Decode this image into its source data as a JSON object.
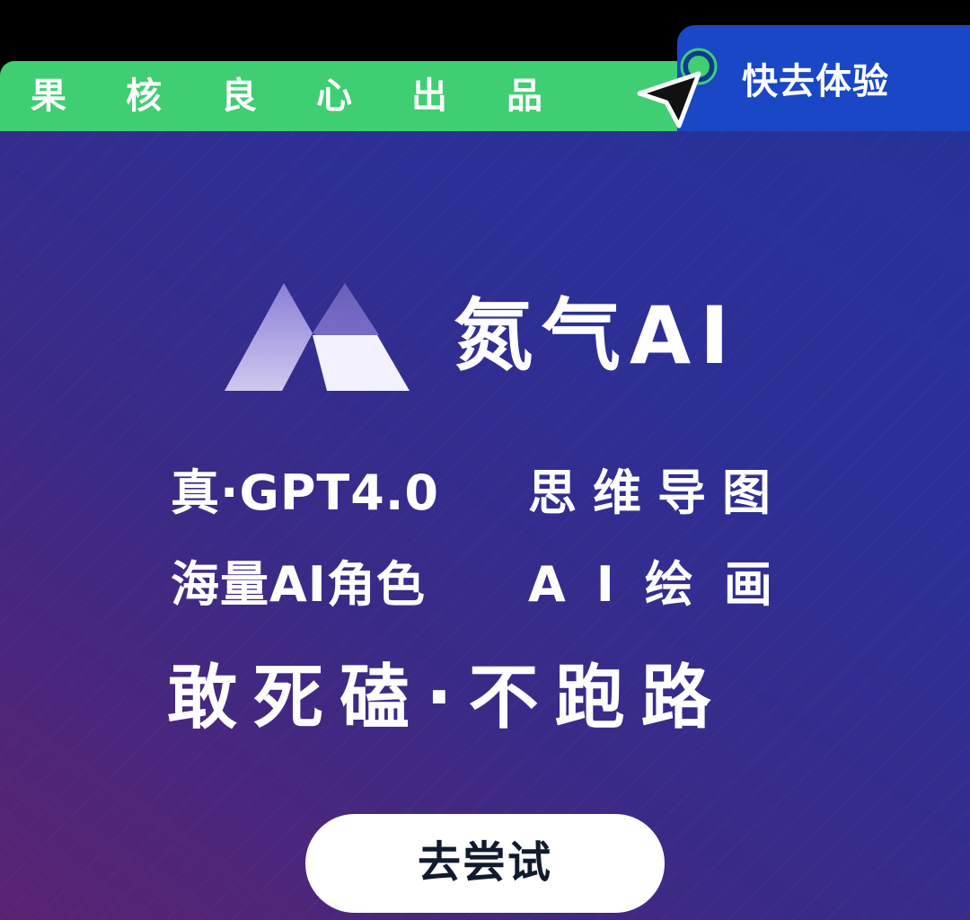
{
  "header": {
    "slogan": "果核良心出品",
    "cta_label": "快去体验"
  },
  "brand": {
    "name": "氮气AI",
    "logo_icon": "nitrogen-logo-mark"
  },
  "features": [
    {
      "label": "真·GPT4.0"
    },
    {
      "label": "思维导图"
    },
    {
      "label": "海量AI角色"
    },
    {
      "label": "AI绘画"
    }
  ],
  "tagline": "敢死磕·不跑路",
  "button": {
    "label": "去尝试"
  },
  "colors": {
    "green_strip": "#3fce72",
    "cta_blue": "#1a47c6",
    "background_top": "#253399",
    "background_bottom": "#5a2372",
    "button_bg": "#ffffff",
    "button_text": "#121a2e"
  },
  "icons": {
    "pointer": "cursor-arrow-icon",
    "indicator": "green-dot-icon"
  }
}
